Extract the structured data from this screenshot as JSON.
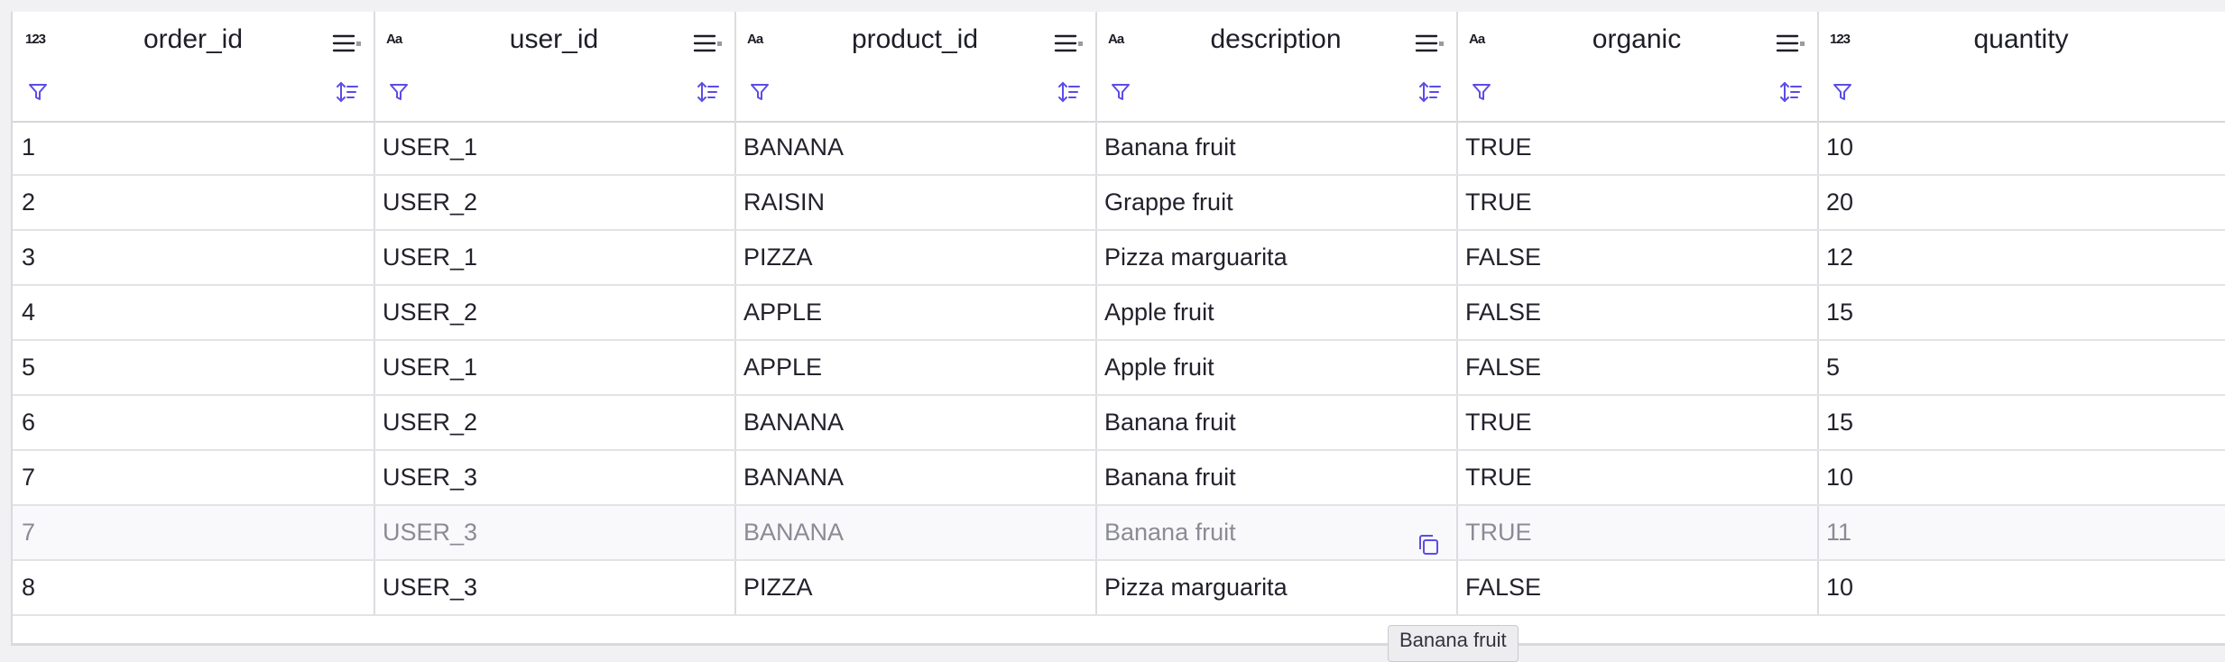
{
  "columns": [
    {
      "name": "order_id",
      "type_icon": "123",
      "has_sort": true
    },
    {
      "name": "user_id",
      "type_icon": "Aa",
      "has_sort": true
    },
    {
      "name": "product_id",
      "type_icon": "Aa",
      "has_sort": true
    },
    {
      "name": "description",
      "type_icon": "Aa",
      "has_sort": true
    },
    {
      "name": "organic",
      "type_icon": "Aa",
      "has_sort": true
    },
    {
      "name": "quantity",
      "type_icon": "123",
      "has_sort": false
    }
  ],
  "rows": [
    [
      "1",
      "USER_1",
      "BANANA",
      "Banana fruit",
      "TRUE",
      "10"
    ],
    [
      "2",
      "USER_2",
      "RAISIN",
      "Grappe fruit",
      "TRUE",
      "20"
    ],
    [
      "3",
      "USER_1",
      "PIZZA",
      "Pizza marguarita",
      "FALSE",
      "12"
    ],
    [
      "4",
      "USER_2",
      "APPLE",
      "Apple fruit",
      "FALSE",
      "15"
    ],
    [
      "5",
      "USER_1",
      "APPLE",
      "Apple fruit",
      "FALSE",
      "5"
    ],
    [
      "6",
      "USER_2",
      "BANANA",
      "Banana fruit",
      "TRUE",
      "15"
    ],
    [
      "7",
      "USER_3",
      "BANANA",
      "Banana fruit",
      "TRUE",
      "10"
    ],
    [
      "7",
      "USER_3",
      "BANANA",
      "Banana fruit",
      "TRUE",
      "11"
    ],
    [
      "8",
      "USER_3",
      "PIZZA",
      "Pizza marguarita",
      "FALSE",
      "10"
    ]
  ],
  "hovered_row_index": 7,
  "copy_icon": "copy-icon",
  "tooltip": {
    "text": "Banana fruit"
  },
  "colors": {
    "accent": "#5b4de6",
    "grid_line": "#dcdce1",
    "text": "#22222c",
    "dim_text": "#8b8b96"
  }
}
